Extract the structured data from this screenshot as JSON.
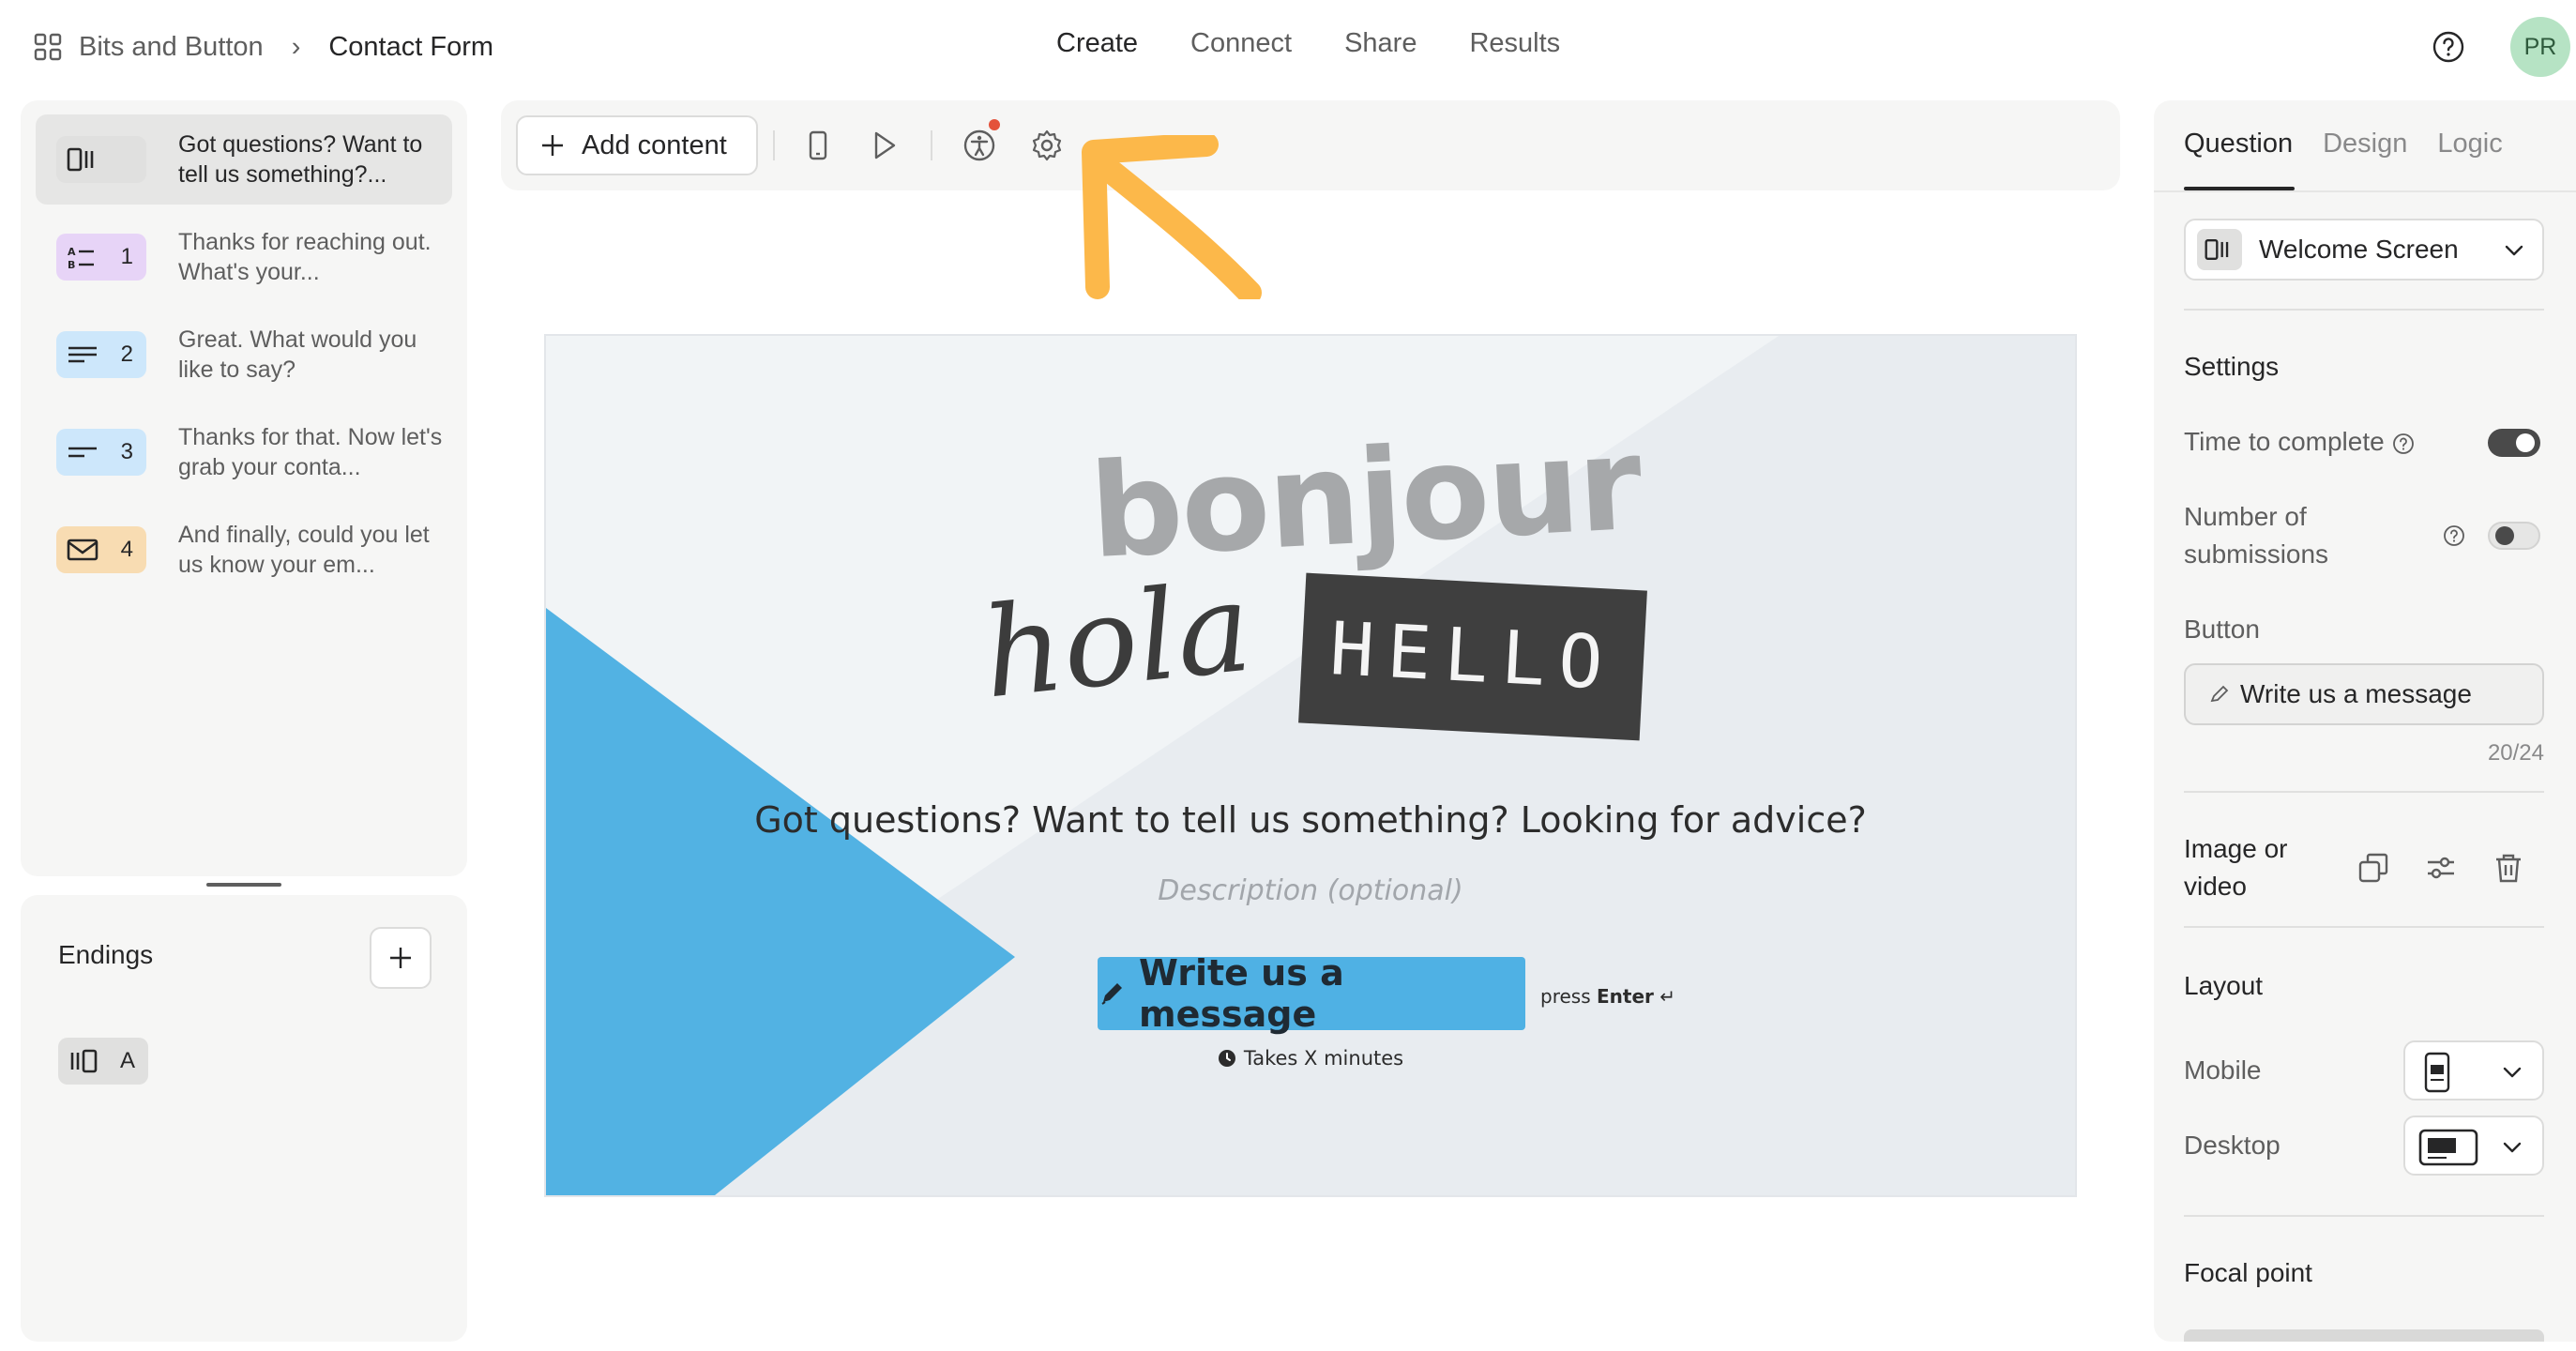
{
  "header": {
    "workspace": "Bits and Button",
    "separator": "›",
    "form_name": "Contact Form",
    "nav": [
      "Create",
      "Connect",
      "Share",
      "Results"
    ],
    "active_nav": "Create",
    "avatar_initials": "PR"
  },
  "questions": [
    {
      "number": "",
      "text": "Got questions? Want to tell us something?...",
      "icon": "welcome-screen-icon",
      "color": "#e6e6e5",
      "selected": true
    },
    {
      "number": "1",
      "text": "Thanks for reaching out. What's your...",
      "icon": "multiple-choice-icon",
      "color": "#e7d4f7"
    },
    {
      "number": "2",
      "text": "Great. What would you like to say?",
      "icon": "long-text-icon",
      "color": "#cde7fb"
    },
    {
      "number": "3",
      "text": "Thanks for that. Now let's grab your conta...",
      "icon": "short-text-icon",
      "color": "#cde7fb"
    },
    {
      "number": "4",
      "text": "And finally, could you let us know your em...",
      "icon": "email-icon",
      "color": "#f8dcb2"
    }
  ],
  "endings": {
    "title": "Endings",
    "items": [
      {
        "label": "A",
        "icon": "ending-screen-icon"
      }
    ]
  },
  "toolbar": {
    "add_content": "Add content"
  },
  "canvas": {
    "title": "Got questions? Want to tell us something? Looking for advice?",
    "description_placeholder": "Description (optional)",
    "button_label": "Write us a message",
    "press_prefix": "press",
    "press_key": "Enter",
    "press_symbol": "↵",
    "time_note": "Takes X minutes",
    "image_words": [
      "bonjour",
      "hola",
      "HELLO"
    ],
    "accent_color": "#4fb1e4"
  },
  "panel": {
    "tabs": [
      "Question",
      "Design",
      "Logic"
    ],
    "active_tab": "Question",
    "type_label": "Welcome Screen",
    "settings_title": "Settings",
    "time_to_complete": {
      "label": "Time to complete",
      "enabled": true
    },
    "number_of_submissions": {
      "label": "Number of submissions",
      "enabled": false
    },
    "button_title": "Button",
    "button_value": "Write us a message",
    "button_counter": "20/24",
    "image_or_video": "Image or video",
    "layout_title": "Layout",
    "mobile_label": "Mobile",
    "desktop_label": "Desktop",
    "focal_point": "Focal point"
  }
}
